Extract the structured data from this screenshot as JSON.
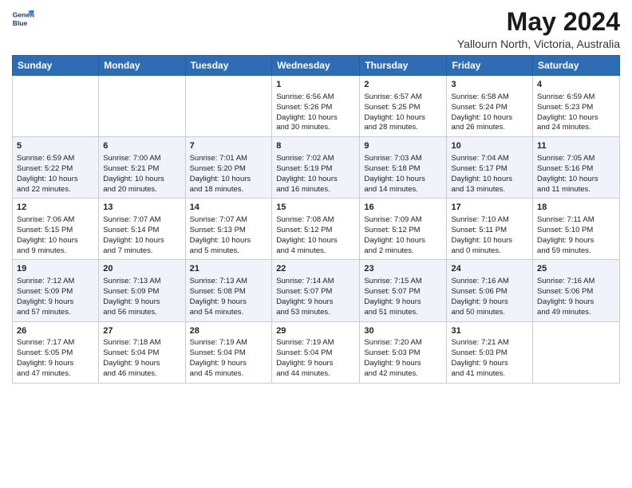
{
  "header": {
    "logo_line1": "General",
    "logo_line2": "Blue",
    "month": "May 2024",
    "location": "Yallourn North, Victoria, Australia"
  },
  "weekdays": [
    "Sunday",
    "Monday",
    "Tuesday",
    "Wednesday",
    "Thursday",
    "Friday",
    "Saturday"
  ],
  "weeks": [
    [
      {
        "day": "",
        "info": ""
      },
      {
        "day": "",
        "info": ""
      },
      {
        "day": "",
        "info": ""
      },
      {
        "day": "1",
        "info": "Sunrise: 6:56 AM\nSunset: 5:26 PM\nDaylight: 10 hours\nand 30 minutes."
      },
      {
        "day": "2",
        "info": "Sunrise: 6:57 AM\nSunset: 5:25 PM\nDaylight: 10 hours\nand 28 minutes."
      },
      {
        "day": "3",
        "info": "Sunrise: 6:58 AM\nSunset: 5:24 PM\nDaylight: 10 hours\nand 26 minutes."
      },
      {
        "day": "4",
        "info": "Sunrise: 6:59 AM\nSunset: 5:23 PM\nDaylight: 10 hours\nand 24 minutes."
      }
    ],
    [
      {
        "day": "5",
        "info": "Sunrise: 6:59 AM\nSunset: 5:22 PM\nDaylight: 10 hours\nand 22 minutes."
      },
      {
        "day": "6",
        "info": "Sunrise: 7:00 AM\nSunset: 5:21 PM\nDaylight: 10 hours\nand 20 minutes."
      },
      {
        "day": "7",
        "info": "Sunrise: 7:01 AM\nSunset: 5:20 PM\nDaylight: 10 hours\nand 18 minutes."
      },
      {
        "day": "8",
        "info": "Sunrise: 7:02 AM\nSunset: 5:19 PM\nDaylight: 10 hours\nand 16 minutes."
      },
      {
        "day": "9",
        "info": "Sunrise: 7:03 AM\nSunset: 5:18 PM\nDaylight: 10 hours\nand 14 minutes."
      },
      {
        "day": "10",
        "info": "Sunrise: 7:04 AM\nSunset: 5:17 PM\nDaylight: 10 hours\nand 13 minutes."
      },
      {
        "day": "11",
        "info": "Sunrise: 7:05 AM\nSunset: 5:16 PM\nDaylight: 10 hours\nand 11 minutes."
      }
    ],
    [
      {
        "day": "12",
        "info": "Sunrise: 7:06 AM\nSunset: 5:15 PM\nDaylight: 10 hours\nand 9 minutes."
      },
      {
        "day": "13",
        "info": "Sunrise: 7:07 AM\nSunset: 5:14 PM\nDaylight: 10 hours\nand 7 minutes."
      },
      {
        "day": "14",
        "info": "Sunrise: 7:07 AM\nSunset: 5:13 PM\nDaylight: 10 hours\nand 5 minutes."
      },
      {
        "day": "15",
        "info": "Sunrise: 7:08 AM\nSunset: 5:12 PM\nDaylight: 10 hours\nand 4 minutes."
      },
      {
        "day": "16",
        "info": "Sunrise: 7:09 AM\nSunset: 5:12 PM\nDaylight: 10 hours\nand 2 minutes."
      },
      {
        "day": "17",
        "info": "Sunrise: 7:10 AM\nSunset: 5:11 PM\nDaylight: 10 hours\nand 0 minutes."
      },
      {
        "day": "18",
        "info": "Sunrise: 7:11 AM\nSunset: 5:10 PM\nDaylight: 9 hours\nand 59 minutes."
      }
    ],
    [
      {
        "day": "19",
        "info": "Sunrise: 7:12 AM\nSunset: 5:09 PM\nDaylight: 9 hours\nand 57 minutes."
      },
      {
        "day": "20",
        "info": "Sunrise: 7:13 AM\nSunset: 5:09 PM\nDaylight: 9 hours\nand 56 minutes."
      },
      {
        "day": "21",
        "info": "Sunrise: 7:13 AM\nSunset: 5:08 PM\nDaylight: 9 hours\nand 54 minutes."
      },
      {
        "day": "22",
        "info": "Sunrise: 7:14 AM\nSunset: 5:07 PM\nDaylight: 9 hours\nand 53 minutes."
      },
      {
        "day": "23",
        "info": "Sunrise: 7:15 AM\nSunset: 5:07 PM\nDaylight: 9 hours\nand 51 minutes."
      },
      {
        "day": "24",
        "info": "Sunrise: 7:16 AM\nSunset: 5:06 PM\nDaylight: 9 hours\nand 50 minutes."
      },
      {
        "day": "25",
        "info": "Sunrise: 7:16 AM\nSunset: 5:06 PM\nDaylight: 9 hours\nand 49 minutes."
      }
    ],
    [
      {
        "day": "26",
        "info": "Sunrise: 7:17 AM\nSunset: 5:05 PM\nDaylight: 9 hours\nand 47 minutes."
      },
      {
        "day": "27",
        "info": "Sunrise: 7:18 AM\nSunset: 5:04 PM\nDaylight: 9 hours\nand 46 minutes."
      },
      {
        "day": "28",
        "info": "Sunrise: 7:19 AM\nSunset: 5:04 PM\nDaylight: 9 hours\nand 45 minutes."
      },
      {
        "day": "29",
        "info": "Sunrise: 7:19 AM\nSunset: 5:04 PM\nDaylight: 9 hours\nand 44 minutes."
      },
      {
        "day": "30",
        "info": "Sunrise: 7:20 AM\nSunset: 5:03 PM\nDaylight: 9 hours\nand 42 minutes."
      },
      {
        "day": "31",
        "info": "Sunrise: 7:21 AM\nSunset: 5:03 PM\nDaylight: 9 hours\nand 41 minutes."
      },
      {
        "day": "",
        "info": ""
      }
    ]
  ]
}
